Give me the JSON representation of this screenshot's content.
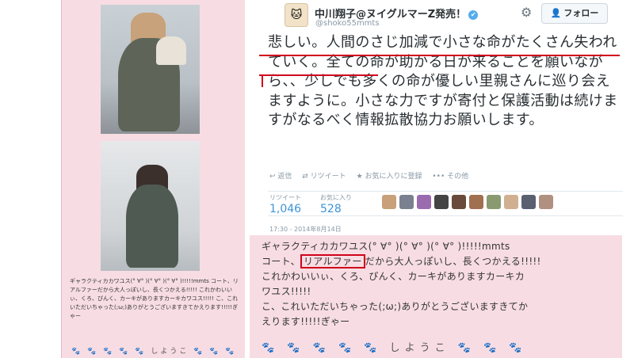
{
  "profile": {
    "name": "中川翔子@ヌイグルマーZ発売！",
    "verified_mark": "✔",
    "handle": "@shoko55mmts",
    "follow_label": "フォロー",
    "avatar_glyph": "🐱"
  },
  "tweet": {
    "text": "悲しい。人間のさじ加減で小さな命がたくさん失われていく。全ての命が助かる日が来ることを願いながら、、少しでも多くの命が優しい里親さんに巡り会えますように。小さな力ですが寄付と保護活動は続けますがなるべく情報拡散協力お願いします。",
    "actions": {
      "reply": "↩ 返信",
      "retweet": "⇄ リツイート",
      "favorite": "★ お気に入りに登録",
      "more": "••• その他"
    },
    "retweets_label": "リツイート",
    "retweets_count": "1,046",
    "favorites_label": "お気に入り",
    "favorites_count": "528",
    "timestamp": "17:30 - 2014年8月14日"
  },
  "blog_small_text": "ギャラクティカカワユス(° ∀° )(° ∀° )(° ∀° )!!!!!mmts コート、リアルファーだから大人っぽいし、長くつかえる!!!!! これかわいいぃ、くろ、ぴんく、カーキがありますカーキカワユス!!!!! こ、これいただいちゃった(;ω;)ありがとうございますきてかえります!!!!!ぎゃー",
  "blog_stickers": "🐾 🐾 🐾 🐾 🐾 しようこ 🐾 🐾 🐾",
  "pink": {
    "line1": "ギャラクティカカワユス(° ∀° )(° ∀° )(° ∀° )!!!!!mmts",
    "line2_pre": "コート、",
    "line2_boxed": "リアルファー",
    "line2_post": "だから大人っぽいし、長くつかえる!!!!!",
    "line3": "これかわいいぃ、くろ、ぴんく、カーキがありますカーキカ",
    "line4": "ワユス!!!!!",
    "line5": "こ、これいただいちゃった(;ω;)ありがとうございますきてか",
    "line6": "えります!!!!!ぎゃー",
    "stickers": "🐾 🐾 🐾 🐾 🐾 しようこ 🐾 🐾 🐾"
  },
  "colors": {
    "accent": "#d0021b",
    "link": "#3b94d9",
    "pink_bg": "#f7dde3"
  }
}
